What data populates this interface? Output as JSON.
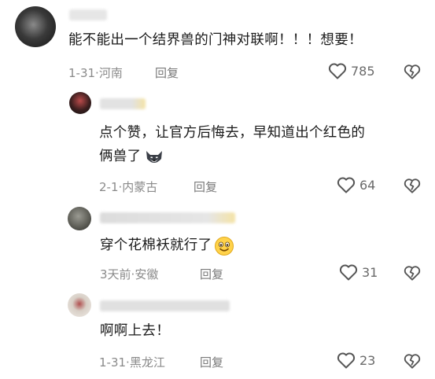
{
  "comments": [
    {
      "text": "能不能出一个结界兽的门神对联啊！！！想要！",
      "date": "1-31",
      "location": "河南",
      "reply_label": "回复",
      "likes": "785",
      "avatar_icon": "blurred-avatar",
      "colors": {
        "avatar": "#3a3a3a"
      }
    },
    {
      "text_line1": "点个赞，让官方后悔去，早知道出个红色的",
      "text_line2": "俩兽了",
      "emoji": "husky-emoji",
      "date": "2-1",
      "location": "内蒙古",
      "reply_label": "回复",
      "likes": "64",
      "avatar_icon": "blurred-avatar",
      "colors": {
        "avatar": "#2b1b1b"
      }
    },
    {
      "text": "穿个花棉袄就行了",
      "emoji": "smile-emoji",
      "date": "3天前",
      "location": "安徽",
      "reply_label": "回复",
      "likes": "31",
      "avatar_icon": "blurred-avatar",
      "colors": {
        "avatar": "#6a6a62"
      }
    },
    {
      "text": "啊啊上去！",
      "date": "1-31",
      "location": "黑龙江",
      "reply_label": "回复",
      "likes": "23",
      "avatar_icon": "blurred-avatar",
      "colors": {
        "avatar": "#c8c0b8"
      }
    }
  ],
  "separator": "·"
}
